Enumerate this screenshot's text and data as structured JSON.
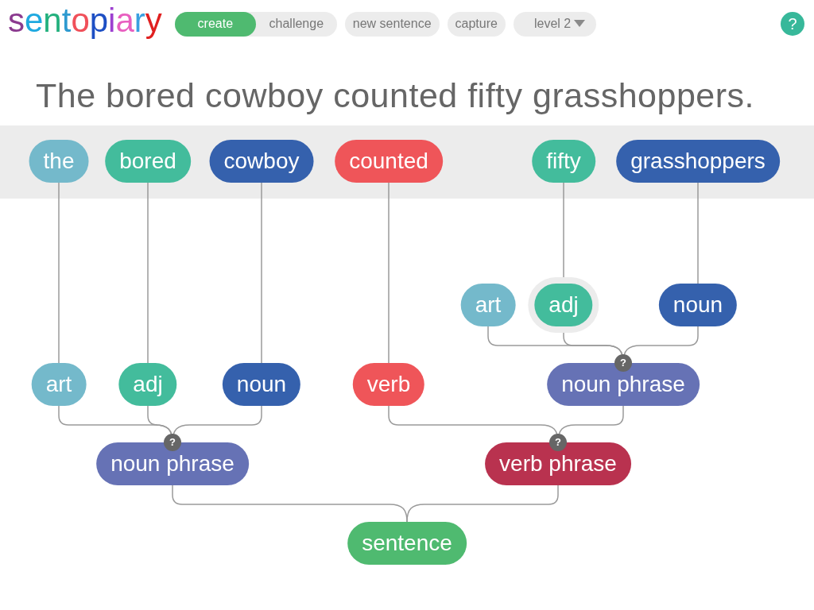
{
  "logo": "sentopiary",
  "modes": [
    {
      "label": "create",
      "selected": true
    },
    {
      "label": "challenge",
      "selected": false
    }
  ],
  "buttons": [
    "new sentence",
    "capture"
  ],
  "level_dropdown": {
    "value": "level 2"
  },
  "help": "?",
  "sentence": "The bored cowboy counted fifty grasshoppers.",
  "words": [
    {
      "text": "the",
      "kind": "art"
    },
    {
      "text": "bored",
      "kind": "adj"
    },
    {
      "text": "cowboy",
      "kind": "noun"
    },
    {
      "text": "counted",
      "kind": "verb"
    },
    {
      "text": "fifty",
      "kind": "adj"
    },
    {
      "text": "grasshoppers",
      "kind": "noun"
    }
  ],
  "tree": {
    "label": "sentence",
    "kind": "sentence",
    "selected": false,
    "children": [
      {
        "label": "noun phrase",
        "kind": "np",
        "selected": false,
        "badge": "?",
        "children": [
          {
            "label": "art",
            "kind": "art",
            "selected": false
          },
          {
            "label": "adj",
            "kind": "adj",
            "selected": false
          },
          {
            "label": "noun",
            "kind": "noun",
            "selected": false
          }
        ]
      },
      {
        "label": "verb phrase",
        "kind": "vp",
        "selected": false,
        "badge": "?",
        "children": [
          {
            "label": "verb",
            "kind": "verb",
            "selected": false
          },
          {
            "label": "noun phrase",
            "kind": "np",
            "selected": false,
            "badge": "?",
            "children": [
              {
                "label": "art",
                "kind": "art",
                "selected": false
              },
              {
                "label": "adj",
                "kind": "adj",
                "selected": true
              },
              {
                "label": "noun",
                "kind": "noun",
                "selected": false
              }
            ]
          }
        ]
      }
    ]
  }
}
